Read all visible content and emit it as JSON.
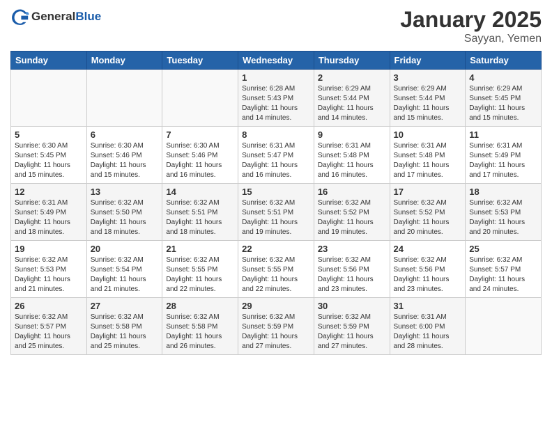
{
  "header": {
    "logo_general": "General",
    "logo_blue": "Blue",
    "month": "January 2025",
    "location": "Sayyan, Yemen"
  },
  "days_of_week": [
    "Sunday",
    "Monday",
    "Tuesday",
    "Wednesday",
    "Thursday",
    "Friday",
    "Saturday"
  ],
  "weeks": [
    [
      {
        "day": "",
        "content": ""
      },
      {
        "day": "",
        "content": ""
      },
      {
        "day": "",
        "content": ""
      },
      {
        "day": "1",
        "content": "Sunrise: 6:28 AM\nSunset: 5:43 PM\nDaylight: 11 hours and 14 minutes."
      },
      {
        "day": "2",
        "content": "Sunrise: 6:29 AM\nSunset: 5:44 PM\nDaylight: 11 hours and 14 minutes."
      },
      {
        "day": "3",
        "content": "Sunrise: 6:29 AM\nSunset: 5:44 PM\nDaylight: 11 hours and 15 minutes."
      },
      {
        "day": "4",
        "content": "Sunrise: 6:29 AM\nSunset: 5:45 PM\nDaylight: 11 hours and 15 minutes."
      }
    ],
    [
      {
        "day": "5",
        "content": "Sunrise: 6:30 AM\nSunset: 5:45 PM\nDaylight: 11 hours and 15 minutes."
      },
      {
        "day": "6",
        "content": "Sunrise: 6:30 AM\nSunset: 5:46 PM\nDaylight: 11 hours and 15 minutes."
      },
      {
        "day": "7",
        "content": "Sunrise: 6:30 AM\nSunset: 5:46 PM\nDaylight: 11 hours and 16 minutes."
      },
      {
        "day": "8",
        "content": "Sunrise: 6:31 AM\nSunset: 5:47 PM\nDaylight: 11 hours and 16 minutes."
      },
      {
        "day": "9",
        "content": "Sunrise: 6:31 AM\nSunset: 5:48 PM\nDaylight: 11 hours and 16 minutes."
      },
      {
        "day": "10",
        "content": "Sunrise: 6:31 AM\nSunset: 5:48 PM\nDaylight: 11 hours and 17 minutes."
      },
      {
        "day": "11",
        "content": "Sunrise: 6:31 AM\nSunset: 5:49 PM\nDaylight: 11 hours and 17 minutes."
      }
    ],
    [
      {
        "day": "12",
        "content": "Sunrise: 6:31 AM\nSunset: 5:49 PM\nDaylight: 11 hours and 18 minutes."
      },
      {
        "day": "13",
        "content": "Sunrise: 6:32 AM\nSunset: 5:50 PM\nDaylight: 11 hours and 18 minutes."
      },
      {
        "day": "14",
        "content": "Sunrise: 6:32 AM\nSunset: 5:51 PM\nDaylight: 11 hours and 18 minutes."
      },
      {
        "day": "15",
        "content": "Sunrise: 6:32 AM\nSunset: 5:51 PM\nDaylight: 11 hours and 19 minutes."
      },
      {
        "day": "16",
        "content": "Sunrise: 6:32 AM\nSunset: 5:52 PM\nDaylight: 11 hours and 19 minutes."
      },
      {
        "day": "17",
        "content": "Sunrise: 6:32 AM\nSunset: 5:52 PM\nDaylight: 11 hours and 20 minutes."
      },
      {
        "day": "18",
        "content": "Sunrise: 6:32 AM\nSunset: 5:53 PM\nDaylight: 11 hours and 20 minutes."
      }
    ],
    [
      {
        "day": "19",
        "content": "Sunrise: 6:32 AM\nSunset: 5:53 PM\nDaylight: 11 hours and 21 minutes."
      },
      {
        "day": "20",
        "content": "Sunrise: 6:32 AM\nSunset: 5:54 PM\nDaylight: 11 hours and 21 minutes."
      },
      {
        "day": "21",
        "content": "Sunrise: 6:32 AM\nSunset: 5:55 PM\nDaylight: 11 hours and 22 minutes."
      },
      {
        "day": "22",
        "content": "Sunrise: 6:32 AM\nSunset: 5:55 PM\nDaylight: 11 hours and 22 minutes."
      },
      {
        "day": "23",
        "content": "Sunrise: 6:32 AM\nSunset: 5:56 PM\nDaylight: 11 hours and 23 minutes."
      },
      {
        "day": "24",
        "content": "Sunrise: 6:32 AM\nSunset: 5:56 PM\nDaylight: 11 hours and 23 minutes."
      },
      {
        "day": "25",
        "content": "Sunrise: 6:32 AM\nSunset: 5:57 PM\nDaylight: 11 hours and 24 minutes."
      }
    ],
    [
      {
        "day": "26",
        "content": "Sunrise: 6:32 AM\nSunset: 5:57 PM\nDaylight: 11 hours and 25 minutes."
      },
      {
        "day": "27",
        "content": "Sunrise: 6:32 AM\nSunset: 5:58 PM\nDaylight: 11 hours and 25 minutes."
      },
      {
        "day": "28",
        "content": "Sunrise: 6:32 AM\nSunset: 5:58 PM\nDaylight: 11 hours and 26 minutes."
      },
      {
        "day": "29",
        "content": "Sunrise: 6:32 AM\nSunset: 5:59 PM\nDaylight: 11 hours and 27 minutes."
      },
      {
        "day": "30",
        "content": "Sunrise: 6:32 AM\nSunset: 5:59 PM\nDaylight: 11 hours and 27 minutes."
      },
      {
        "day": "31",
        "content": "Sunrise: 6:31 AM\nSunset: 6:00 PM\nDaylight: 11 hours and 28 minutes."
      },
      {
        "day": "",
        "content": ""
      }
    ]
  ]
}
